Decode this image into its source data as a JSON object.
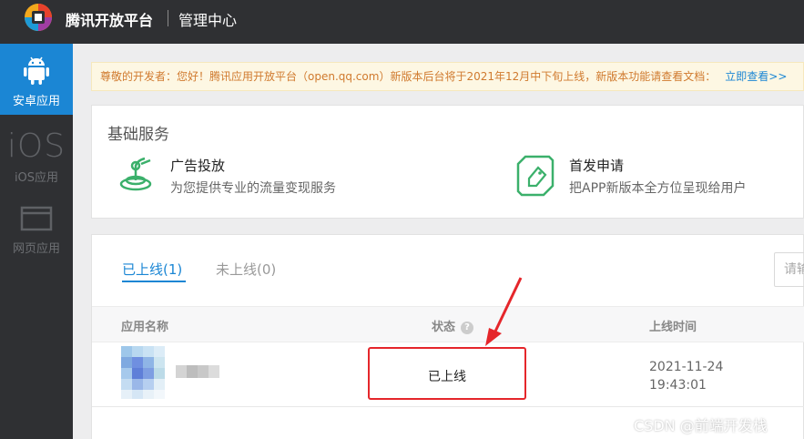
{
  "header": {
    "brand": "腾讯开放平台",
    "section": "管理中心"
  },
  "sidebar": {
    "items": [
      {
        "label": "安卓应用",
        "icon": "android-icon",
        "active": true
      },
      {
        "label": "iOS应用",
        "icon_text": "iOS",
        "active": false
      },
      {
        "label": "网页应用",
        "icon": "web-window-icon",
        "active": false
      }
    ]
  },
  "notice": {
    "text": "尊敬的开发者：您好！腾讯应用开放平台（open.qq.com）新版本后台将于2021年12月中下旬上线，新版本功能请查看文档：",
    "link": "立即查看>>"
  },
  "basic_services": {
    "title": "基础服务",
    "items": [
      {
        "title": "广告投放",
        "desc": "为您提供专业的流量变现服务",
        "icon": "ad-delivery-icon"
      },
      {
        "title": "首发申请",
        "desc": "把APP新版本全方位呈现给用户",
        "icon": "launch-tag-icon"
      }
    ]
  },
  "apps": {
    "tabs": [
      {
        "label": "已上线(1)",
        "active": true
      },
      {
        "label": "未上线(0)",
        "active": false
      }
    ],
    "search_placeholder": "请输",
    "columns": [
      "应用名称",
      "状态",
      "上线时间"
    ],
    "rows": [
      {
        "status": "已上线",
        "time_date": "2021-11-24",
        "time_clock": "19:43:01"
      }
    ]
  },
  "watermark": "CSDN @前端开发栈",
  "colors": {
    "accent": "#1b86d4",
    "highlight": "#e5262b",
    "notice_text": "#d07a2e",
    "icon_green": "#3bb06b"
  }
}
